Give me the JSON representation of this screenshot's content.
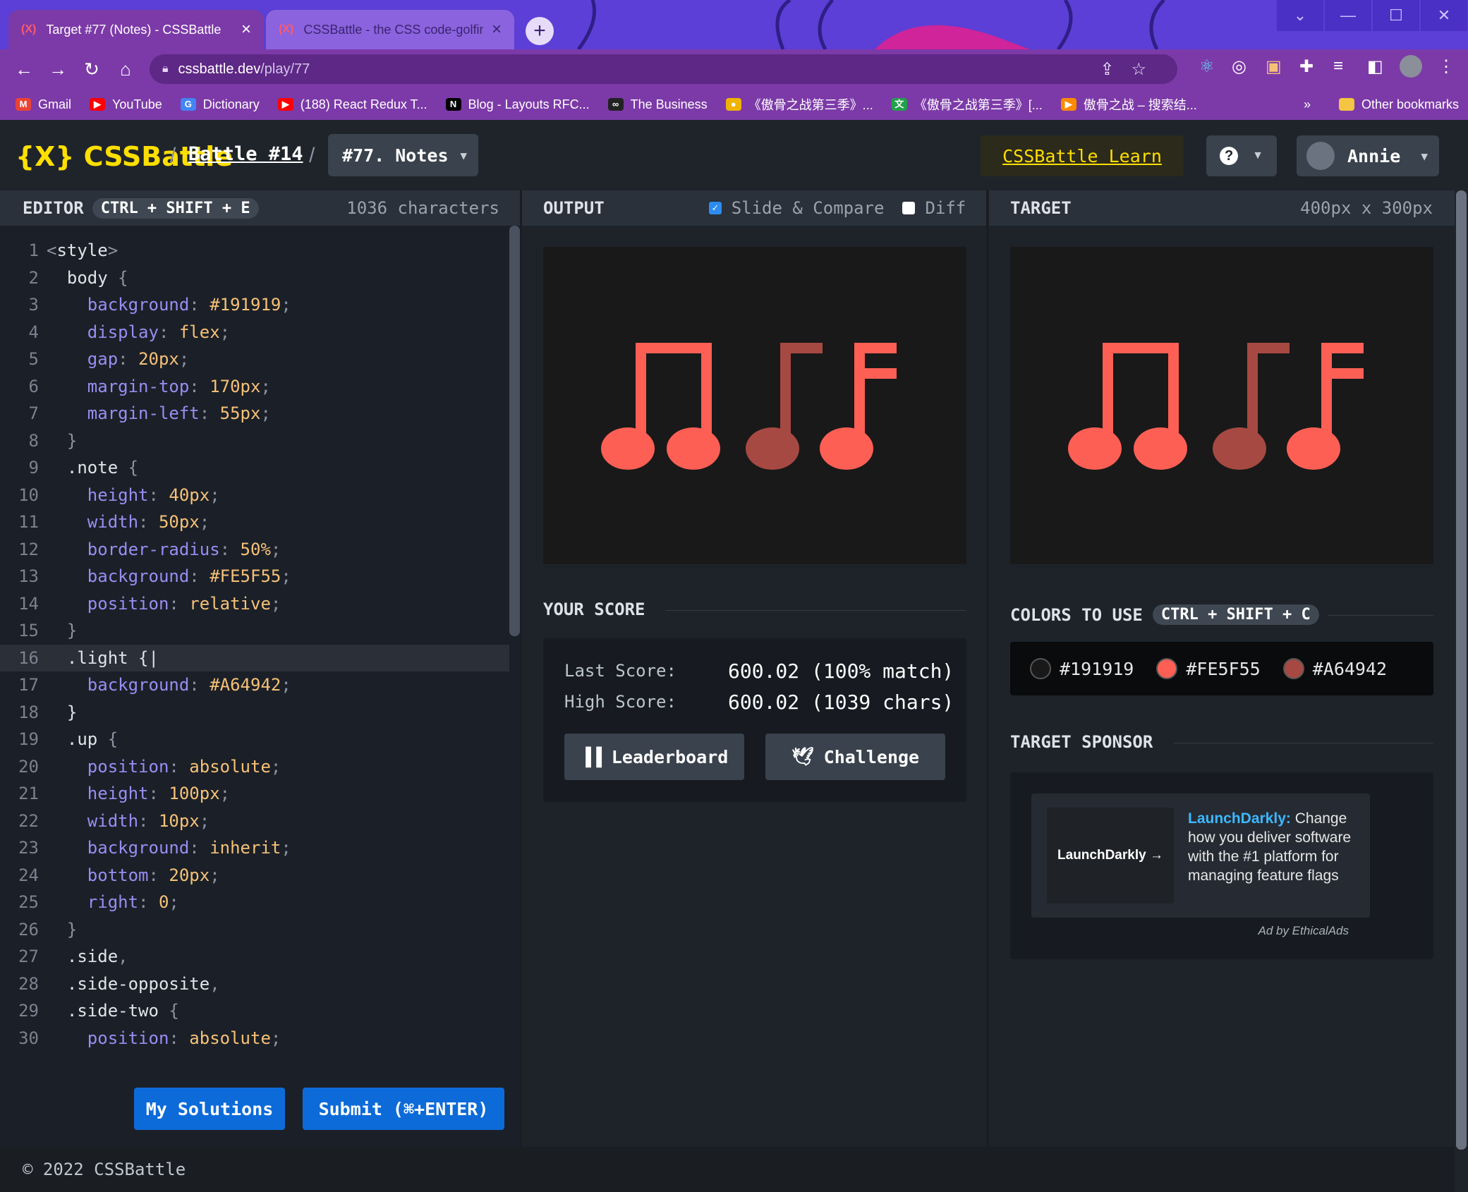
{
  "browser": {
    "tabs": [
      {
        "title": "Target #77 (Notes) - CSSBattle",
        "favicon": "(X)"
      },
      {
        "title": "CSSBattle - the CSS code-golfing",
        "favicon": "(X)"
      }
    ],
    "url_host": "cssbattle.dev",
    "url_path": "/play/77",
    "bookmarks": [
      {
        "label": "Gmail",
        "icon": "gmail-icon",
        "glyph": "M",
        "color": "#ea4335"
      },
      {
        "label": "YouTube",
        "icon": "youtube-icon",
        "glyph": "▶",
        "color": "#ff0000"
      },
      {
        "label": "Dictionary",
        "icon": "google-icon",
        "glyph": "G",
        "color": "#4285f4"
      },
      {
        "label": "(188) React Redux T...",
        "icon": "youtube-icon",
        "glyph": "▶",
        "color": "#ff0000"
      },
      {
        "label": "Blog - Layouts RFC...",
        "icon": "nextjs-icon",
        "glyph": "N",
        "color": "#000000"
      },
      {
        "label": "The Business",
        "icon": "business-icon",
        "glyph": "∞",
        "color": "#222222"
      },
      {
        "label": "《傲骨之战第三季》...",
        "icon": "smiley-icon",
        "glyph": "●",
        "color": "#f0b400"
      },
      {
        "label": "《傲骨之战第三季》[...",
        "icon": "translate-icon",
        "glyph": "文",
        "color": "#22a04a"
      },
      {
        "label": "傲骨之战 – 搜索结...",
        "icon": "play-icon",
        "glyph": "▶",
        "color": "#ff8a00"
      }
    ],
    "bookmarks_more": "»",
    "other_bookmarks": "Other bookmarks"
  },
  "header": {
    "logo": "{X} CSSBattle",
    "battle": "Battle #14",
    "separator": "/",
    "target": "#77. Notes",
    "learn": "CSSBattle Learn",
    "user": "Annie"
  },
  "editor": {
    "title": "EDITOR",
    "shortcut": "CTRL + SHIFT + E",
    "chars": "1036 characters",
    "lines": [
      [
        [
          "p",
          "<"
        ],
        [
          "t",
          "style"
        ],
        [
          "p",
          ">"
        ]
      ],
      [
        [
          "t",
          "  body "
        ],
        [
          "p",
          "{"
        ]
      ],
      [
        [
          "k",
          "    background"
        ],
        [
          "p",
          ": "
        ],
        [
          "v",
          "#191919"
        ],
        [
          "p",
          ";"
        ]
      ],
      [
        [
          "k",
          "    display"
        ],
        [
          "p",
          ": "
        ],
        [
          "v",
          "flex"
        ],
        [
          "p",
          ";"
        ]
      ],
      [
        [
          "k",
          "    gap"
        ],
        [
          "p",
          ": "
        ],
        [
          "v",
          "20px"
        ],
        [
          "p",
          ";"
        ]
      ],
      [
        [
          "k",
          "    margin-top"
        ],
        [
          "p",
          ": "
        ],
        [
          "v",
          "170px"
        ],
        [
          "p",
          ";"
        ]
      ],
      [
        [
          "k",
          "    margin-left"
        ],
        [
          "p",
          ": "
        ],
        [
          "v",
          "55px"
        ],
        [
          "p",
          ";"
        ]
      ],
      [
        [
          "p",
          "  }"
        ]
      ],
      [
        [
          "t",
          "  .note "
        ],
        [
          "p",
          "{"
        ]
      ],
      [
        [
          "k",
          "    height"
        ],
        [
          "p",
          ": "
        ],
        [
          "v",
          "40px"
        ],
        [
          "p",
          ";"
        ]
      ],
      [
        [
          "k",
          "    width"
        ],
        [
          "p",
          ": "
        ],
        [
          "v",
          "50px"
        ],
        [
          "p",
          ";"
        ]
      ],
      [
        [
          "k",
          "    border-radius"
        ],
        [
          "p",
          ": "
        ],
        [
          "v",
          "50%"
        ],
        [
          "p",
          ";"
        ]
      ],
      [
        [
          "k",
          "    background"
        ],
        [
          "p",
          ": "
        ],
        [
          "v",
          "#FE5F55"
        ],
        [
          "p",
          ";"
        ]
      ],
      [
        [
          "k",
          "    position"
        ],
        [
          "p",
          ": "
        ],
        [
          "v",
          "relative"
        ],
        [
          "p",
          ";"
        ]
      ],
      [
        [
          "p",
          "  }"
        ]
      ],
      [
        [
          "t",
          "  .light "
        ],
        [
          "t",
          "{"
        ],
        [
          "t",
          "|"
        ]
      ],
      [
        [
          "k",
          "    background"
        ],
        [
          "p",
          ": "
        ],
        [
          "v",
          "#A64942"
        ],
        [
          "p",
          ";"
        ]
      ],
      [
        [
          "t",
          "  }"
        ]
      ],
      [
        [
          "t",
          "  .up "
        ],
        [
          "p",
          "{"
        ]
      ],
      [
        [
          "k",
          "    position"
        ],
        [
          "p",
          ": "
        ],
        [
          "v",
          "absolute"
        ],
        [
          "p",
          ";"
        ]
      ],
      [
        [
          "k",
          "    height"
        ],
        [
          "p",
          ": "
        ],
        [
          "v",
          "100px"
        ],
        [
          "p",
          ";"
        ]
      ],
      [
        [
          "k",
          "    width"
        ],
        [
          "p",
          ": "
        ],
        [
          "v",
          "10px"
        ],
        [
          "p",
          ";"
        ]
      ],
      [
        [
          "k",
          "    background"
        ],
        [
          "p",
          ": "
        ],
        [
          "v",
          "inherit"
        ],
        [
          "p",
          ";"
        ]
      ],
      [
        [
          "k",
          "    bottom"
        ],
        [
          "p",
          ": "
        ],
        [
          "v",
          "20px"
        ],
        [
          "p",
          ";"
        ]
      ],
      [
        [
          "k",
          "    right"
        ],
        [
          "p",
          ": "
        ],
        [
          "v",
          "0"
        ],
        [
          "p",
          ";"
        ]
      ],
      [
        [
          "p",
          "  }"
        ]
      ],
      [
        [
          "t",
          "  .side"
        ],
        [
          "p",
          ","
        ]
      ],
      [
        [
          "t",
          "  .side-opposite"
        ],
        [
          "p",
          ","
        ]
      ],
      [
        [
          "t",
          "  .side-two "
        ],
        [
          "p",
          "{"
        ]
      ],
      [
        [
          "k",
          "    position"
        ],
        [
          "p",
          ": "
        ],
        [
          "v",
          "absolute"
        ],
        [
          "p",
          ";"
        ]
      ]
    ],
    "my_solutions": "My Solutions",
    "submit": "Submit (⌘+ENTER)"
  },
  "output": {
    "title": "OUTPUT",
    "slide_compare": "Slide & Compare",
    "slide_compare_checked": true,
    "diff": "Diff",
    "diff_checked": false,
    "score_title": "YOUR SCORE",
    "last_score_label": "Last Score:",
    "last_score_value": "600.02 (100% match)",
    "high_score_label": "High Score:",
    "high_score_value": "600.02 (1039 chars)",
    "leaderboard": "Leaderboard",
    "challenge": "Challenge"
  },
  "target": {
    "title": "TARGET",
    "dimensions": "400px x 300px",
    "colors_title": "COLORS TO USE",
    "colors_shortcut": "CTRL + SHIFT + C",
    "colors": [
      "#191919",
      "#FE5F55",
      "#A64942"
    ],
    "sponsor_title": "TARGET SPONSOR",
    "ad_brand": "LaunchDarkly",
    "ad_logo": "LaunchDarkly →",
    "ad_text": " Change how you deliver software with the #1 platform for managing feature flags",
    "ad_by": "Ad by EthicalAds"
  },
  "footer": "© 2022 CSSBattle"
}
